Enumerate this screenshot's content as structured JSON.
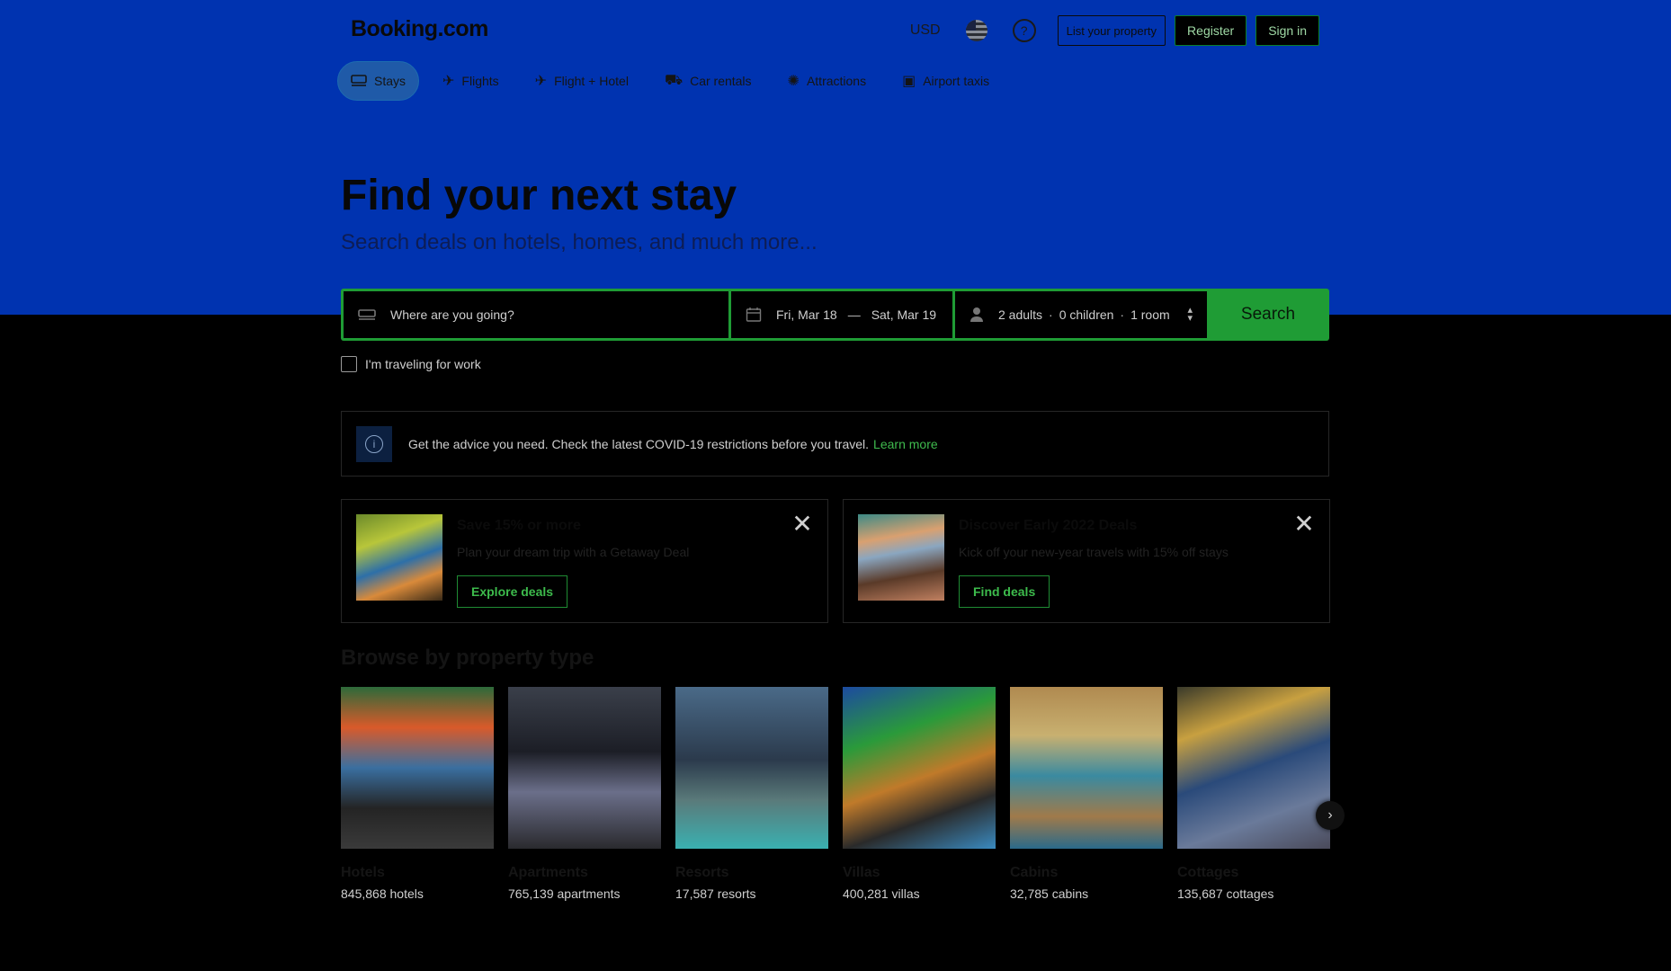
{
  "header": {
    "logo": "Booking.com",
    "currency": "USD",
    "list_property": "List your property",
    "register": "Register",
    "sign_in": "Sign in"
  },
  "nav": {
    "tabs": [
      {
        "label": "Stays",
        "icon": "bed-icon"
      },
      {
        "label": "Flights",
        "icon": "plane-icon"
      },
      {
        "label": "Flight + Hotel",
        "icon": "flight-hotel-icon"
      },
      {
        "label": "Car rentals",
        "icon": "car-icon"
      },
      {
        "label": "Attractions",
        "icon": "attractions-icon"
      },
      {
        "label": "Airport taxis",
        "icon": "taxi-icon"
      }
    ]
  },
  "hero": {
    "title": "Find your next stay",
    "subtitle": "Search deals on hotels, homes, and much more..."
  },
  "search": {
    "destination_placeholder": "Where are you going?",
    "checkin": "Fri, Mar 18",
    "date_separator": "—",
    "checkout": "Sat, Mar 19",
    "adults": "2 adults",
    "children": "0 children",
    "rooms": "1 room",
    "guest_separator": "·",
    "button": "Search",
    "work_label": "I'm traveling for work"
  },
  "covid": {
    "text": "Get the advice you need. Check the latest COVID-19 restrictions before you travel.",
    "link": "Learn more"
  },
  "deals": [
    {
      "title": "Save 15% or more",
      "desc": "Plan your dream trip with a Getaway Deal",
      "button": "Explore deals"
    },
    {
      "title": "Discover Early 2022 Deals",
      "desc": "Kick off your new-year travels with 15% off stays",
      "button": "Find deals"
    }
  ],
  "browse": {
    "title": "Browse by property type",
    "items": [
      {
        "name": "Hotels",
        "count": "845,868 hotels"
      },
      {
        "name": "Apartments",
        "count": "765,139 apartments"
      },
      {
        "name": "Resorts",
        "count": "17,587 resorts"
      },
      {
        "name": "Villas",
        "count": "400,281 villas"
      },
      {
        "name": "Cabins",
        "count": "32,785 cabins"
      },
      {
        "name": "Cottages",
        "count": "135,687 cottages"
      }
    ]
  },
  "colors": {
    "hero_bg": "#0033b0",
    "accent_green": "#1f9c35",
    "link_green": "#3fbb4e",
    "page_bg": "#000000"
  }
}
